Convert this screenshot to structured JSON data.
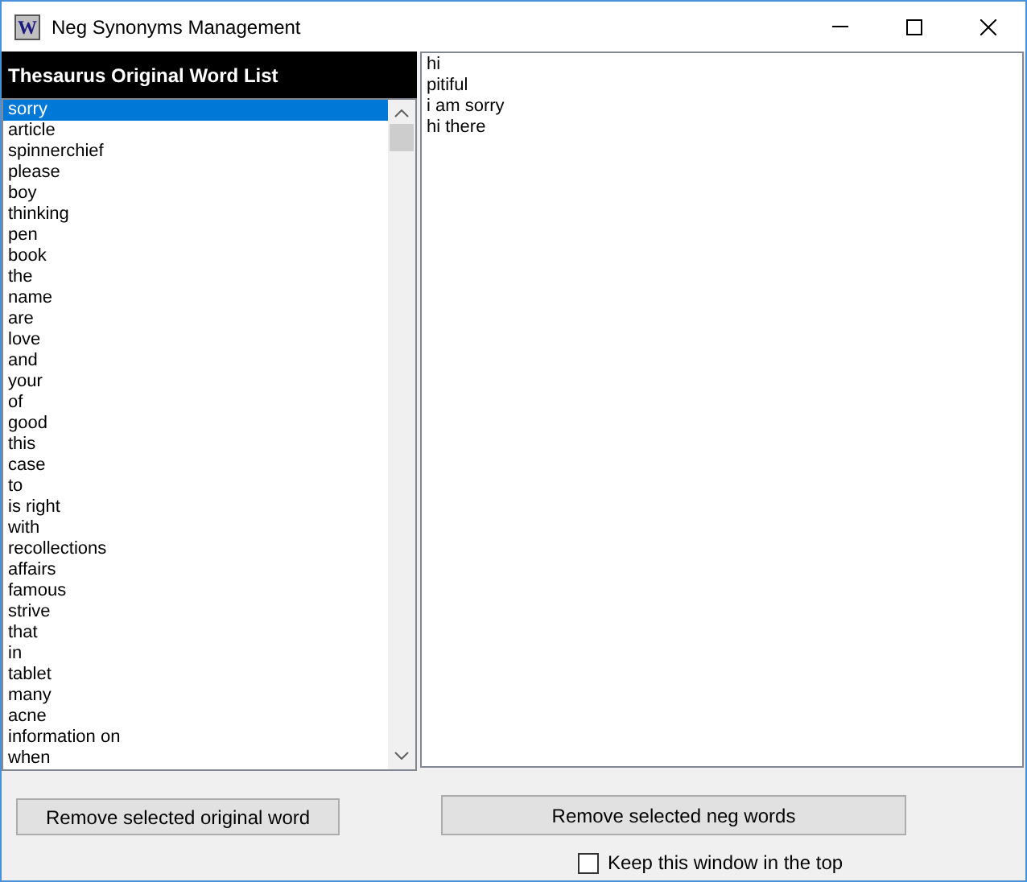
{
  "window": {
    "icon_letter": "W",
    "title": "Neg Synonyms Management"
  },
  "original_list": {
    "header": "Thesaurus Original Word List",
    "items": [
      {
        "label": "sorry",
        "selected": true
      },
      {
        "label": "article",
        "selected": false
      },
      {
        "label": "spinnerchief",
        "selected": false
      },
      {
        "label": "please",
        "selected": false
      },
      {
        "label": "boy",
        "selected": false
      },
      {
        "label": "thinking",
        "selected": false
      },
      {
        "label": "pen",
        "selected": false
      },
      {
        "label": "book",
        "selected": false
      },
      {
        "label": "the",
        "selected": false
      },
      {
        "label": "name",
        "selected": false
      },
      {
        "label": "are",
        "selected": false
      },
      {
        "label": "love",
        "selected": false
      },
      {
        "label": "and",
        "selected": false
      },
      {
        "label": "your",
        "selected": false
      },
      {
        "label": "of",
        "selected": false
      },
      {
        "label": "good",
        "selected": false
      },
      {
        "label": "this",
        "selected": false
      },
      {
        "label": "case",
        "selected": false
      },
      {
        "label": "to",
        "selected": false
      },
      {
        "label": "is right",
        "selected": false
      },
      {
        "label": "with",
        "selected": false
      },
      {
        "label": "recollections",
        "selected": false
      },
      {
        "label": "affairs",
        "selected": false
      },
      {
        "label": "famous",
        "selected": false
      },
      {
        "label": "strive",
        "selected": false
      },
      {
        "label": "that",
        "selected": false
      },
      {
        "label": "in",
        "selected": false
      },
      {
        "label": "tablet",
        "selected": false
      },
      {
        "label": "many",
        "selected": false
      },
      {
        "label": "acne",
        "selected": false
      },
      {
        "label": "information on",
        "selected": false
      },
      {
        "label": "when",
        "selected": false
      }
    ]
  },
  "neg_list": {
    "items": [
      {
        "label": "hi",
        "selected": false
      },
      {
        "label": "pitiful",
        "selected": false
      },
      {
        "label": "i am sorry",
        "selected": false
      },
      {
        "label": "hi there",
        "selected": false
      }
    ]
  },
  "buttons": {
    "remove_original": "Remove selected original word",
    "remove_neg": "Remove selected neg words"
  },
  "keep_on_top": {
    "label": "Keep this window in the top",
    "checked": false
  }
}
